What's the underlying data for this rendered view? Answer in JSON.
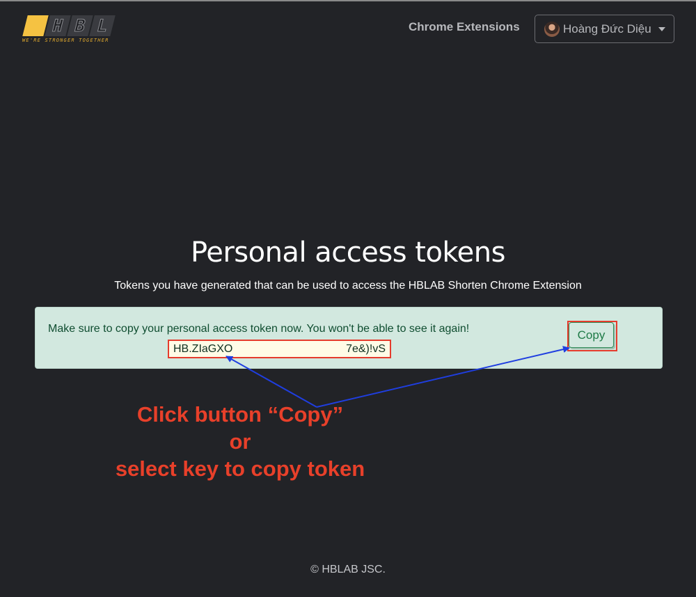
{
  "logo": {
    "letters": [
      "H",
      "B",
      "L"
    ],
    "tagline": "WE'RE STRONGER TOGETHER",
    "colors": {
      "tile": "#f5c242",
      "tagline": "#e0a92e"
    }
  },
  "header": {
    "nav_link": "Chrome Extensions",
    "user": {
      "name": "Hoàng Đức Diệu",
      "avatar_icon": "avatar-photo",
      "caret_icon": "caret-down-icon"
    }
  },
  "main": {
    "title": "Personal access tokens",
    "subtitle": "Tokens you have generated that can be used to access the HBLAB Shorten Chrome Extension",
    "alert": {
      "message": "Make sure to copy your personal access token now. You won't be able to see it again!",
      "token_start": "HB.ZIaGXO",
      "token_end": "7e&)!vS",
      "copy_label": "Copy",
      "bg_color": "#d2e8df"
    }
  },
  "annotation": {
    "lines": [
      "Click button “Copy”",
      "or",
      "select key to copy token"
    ],
    "text_color": "#e8402a",
    "arrow_color": "#1f3ee0",
    "highlight_color": "#e53b2c"
  },
  "footer": {
    "text": "© HBLAB JSC."
  }
}
